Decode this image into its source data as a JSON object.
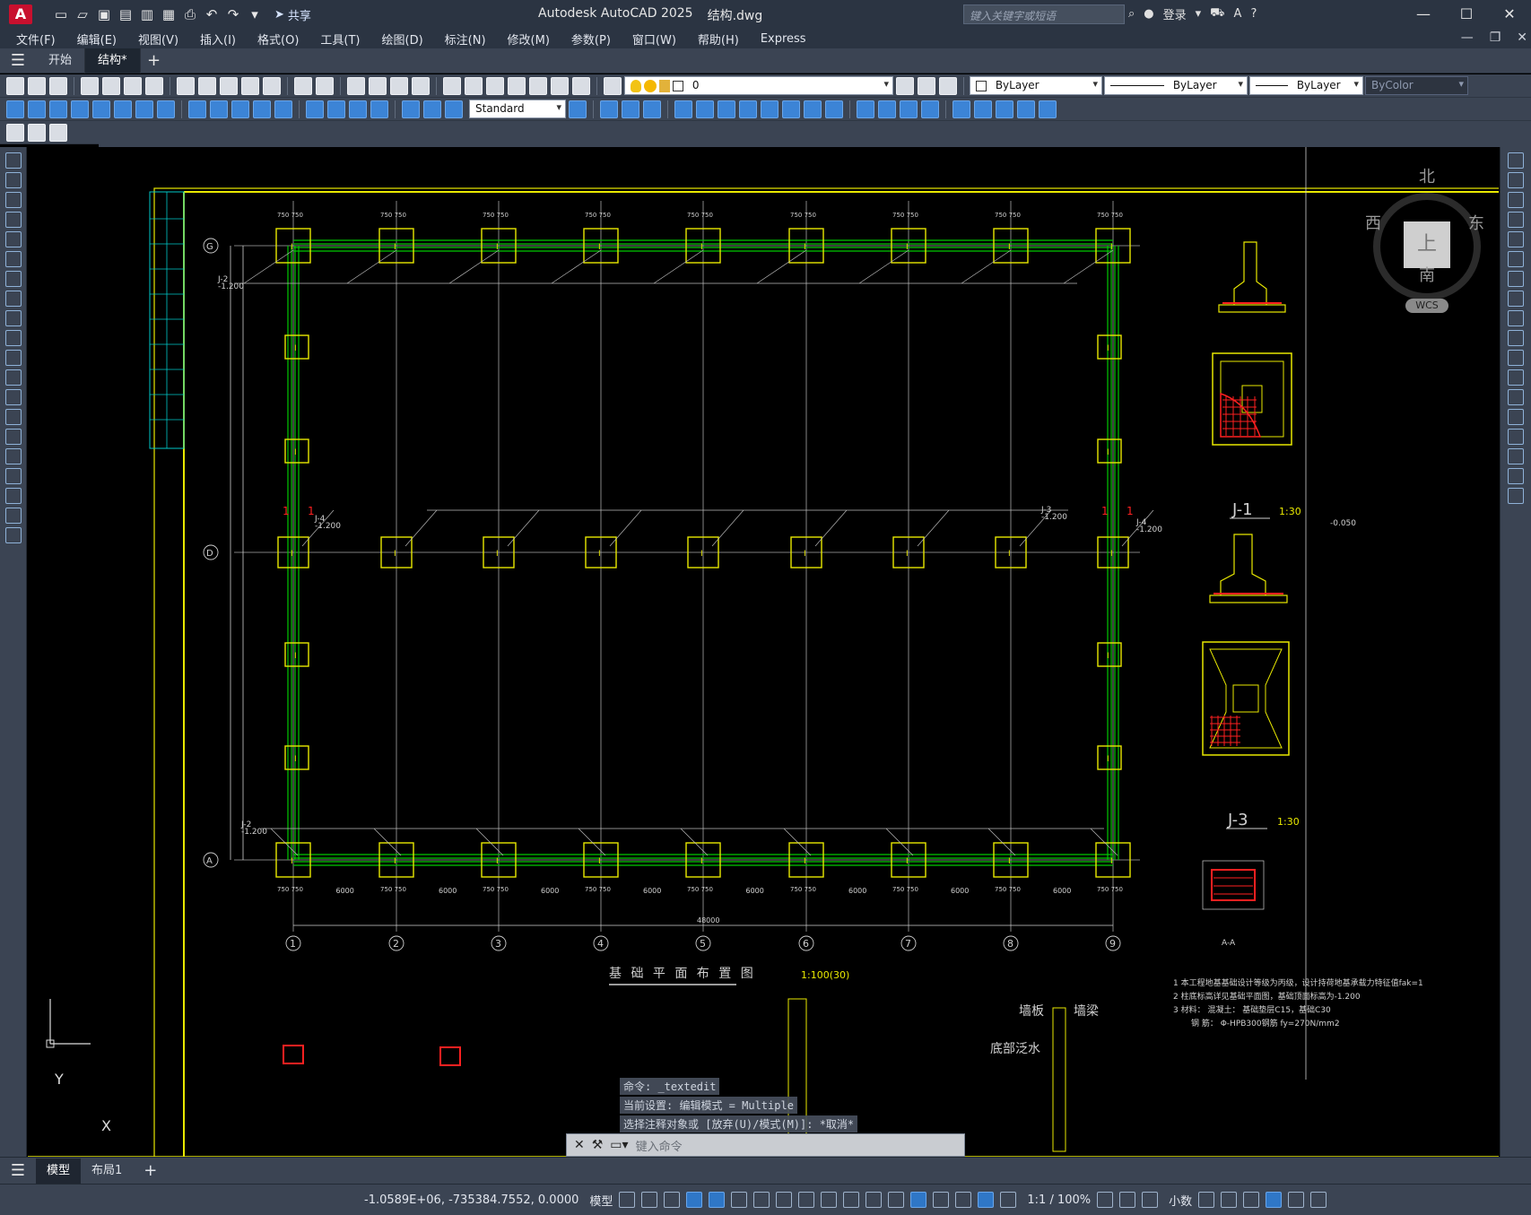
{
  "titlebar": {
    "app_logo": "A",
    "app_name": "Autodesk AutoCAD 2025",
    "file_name": "结构.dwg",
    "share_label": "共享",
    "search_placeholder": "键入关键字或短语",
    "login_label": "登录"
  },
  "menu": [
    "文件(F)",
    "编辑(E)",
    "视图(V)",
    "插入(I)",
    "格式(O)",
    "工具(T)",
    "绘图(D)",
    "标注(N)",
    "修改(M)",
    "参数(P)",
    "窗口(W)",
    "帮助(H)",
    "Express"
  ],
  "doc_tabs": {
    "start": "开始",
    "current": "结构*"
  },
  "toolbar": {
    "layer_name": "0",
    "color": "ByLayer",
    "linetype": "ByLayer",
    "lineweight": "ByLayer",
    "plotstyle": "ByColor",
    "text_style": "Standard"
  },
  "viewcube": {
    "north": "北",
    "south": "南",
    "east": "东",
    "west": "西",
    "face": "上",
    "wcs": "WCS"
  },
  "drawing": {
    "title": "基 础 平 面 布 置 图",
    "scale": "1:100(30)",
    "grid_rows": [
      "G",
      "D",
      "A"
    ],
    "grid_cols": [
      "1",
      "2",
      "3",
      "4",
      "5",
      "6",
      "7",
      "8",
      "9"
    ],
    "bay_dim": "6000",
    "total_dim": "48000",
    "detail_j1": "J-1",
    "detail_j3": "J-3",
    "detail_scale": "1:30",
    "detail_aa": "A-A",
    "elev_1": "-0.050",
    "elev_2": "-1.200",
    "col_dim": "750 750",
    "tag_j2": "J-2",
    "tag_j4": "J-4",
    "tag_j3": "J-3",
    "lbl_wall": "墙板",
    "lbl_ridge": "墙梁",
    "lbl_water": "底部泛水",
    "note_1": "1 本工程地基基础设计等级为丙级，设计持荷地基承载力特征值fak=1",
    "note_2": "2 柱底标高详见基础平面图，基础顶面标高为-1.200",
    "note_3": "3 材料： 混凝土： 基础垫层C15，基础C30",
    "note_4": "钢 筋： Φ-HPB300钢筋 fy=270N/mm2"
  },
  "command": {
    "line1": "命令: _textedit",
    "line2": "当前设置: 编辑模式 = Multiple",
    "line3": "选择注释对象或 [放弃(U)/模式(M)]: *取消*",
    "placeholder": "键入命令"
  },
  "layout_tabs": {
    "model": "模型",
    "layout1": "布局1"
  },
  "status": {
    "coords": "-1.0589E+06, -735384.7552, 0.0000",
    "model": "模型",
    "scale": "1:1 / 100%",
    "units": "小数"
  },
  "ucs": {
    "x": "X",
    "y": "Y"
  },
  "colors": {
    "accent": "#2f77c7",
    "cad_yellow": "#e8e800",
    "cad_green": "#00c800",
    "cad_red": "#ff0000",
    "cad_cyan": "#00c8c8"
  }
}
